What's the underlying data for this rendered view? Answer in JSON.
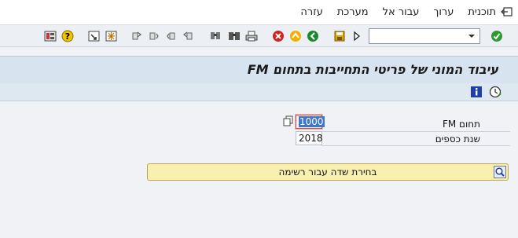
{
  "menu": {
    "items": [
      "תוכנית",
      "ערוך",
      "עבור אל",
      "מערכת",
      "עזרה"
    ]
  },
  "toolbar": {
    "command_value": ""
  },
  "screen": {
    "title": "עיבוד המוני של פריטי התחייבות בתחום FM"
  },
  "form": {
    "fm_area_label": "תחום FM",
    "fm_area_value": "1000",
    "fiscal_year_label": "שנת כספים",
    "fiscal_year_value": "2018"
  },
  "search": {
    "label": "בחירת שדה עבור רשימה"
  },
  "colors": {
    "title_bar": "#d7e3ee",
    "search_bar": "#f8f0b0",
    "active_border": "#e04545"
  },
  "icons": [
    "exit-icon",
    "save-icon",
    "back-icon",
    "exit-green-icon",
    "cancel-icon",
    "print-icon",
    "find-icon",
    "find-next-icon",
    "first-page-icon",
    "previous-page-icon",
    "next-page-icon",
    "last-page-icon",
    "new-session-icon",
    "shortcut-icon",
    "help-icon",
    "layout-icon",
    "execute-icon",
    "info-icon",
    "clock-icon",
    "dropdown-icon"
  ]
}
